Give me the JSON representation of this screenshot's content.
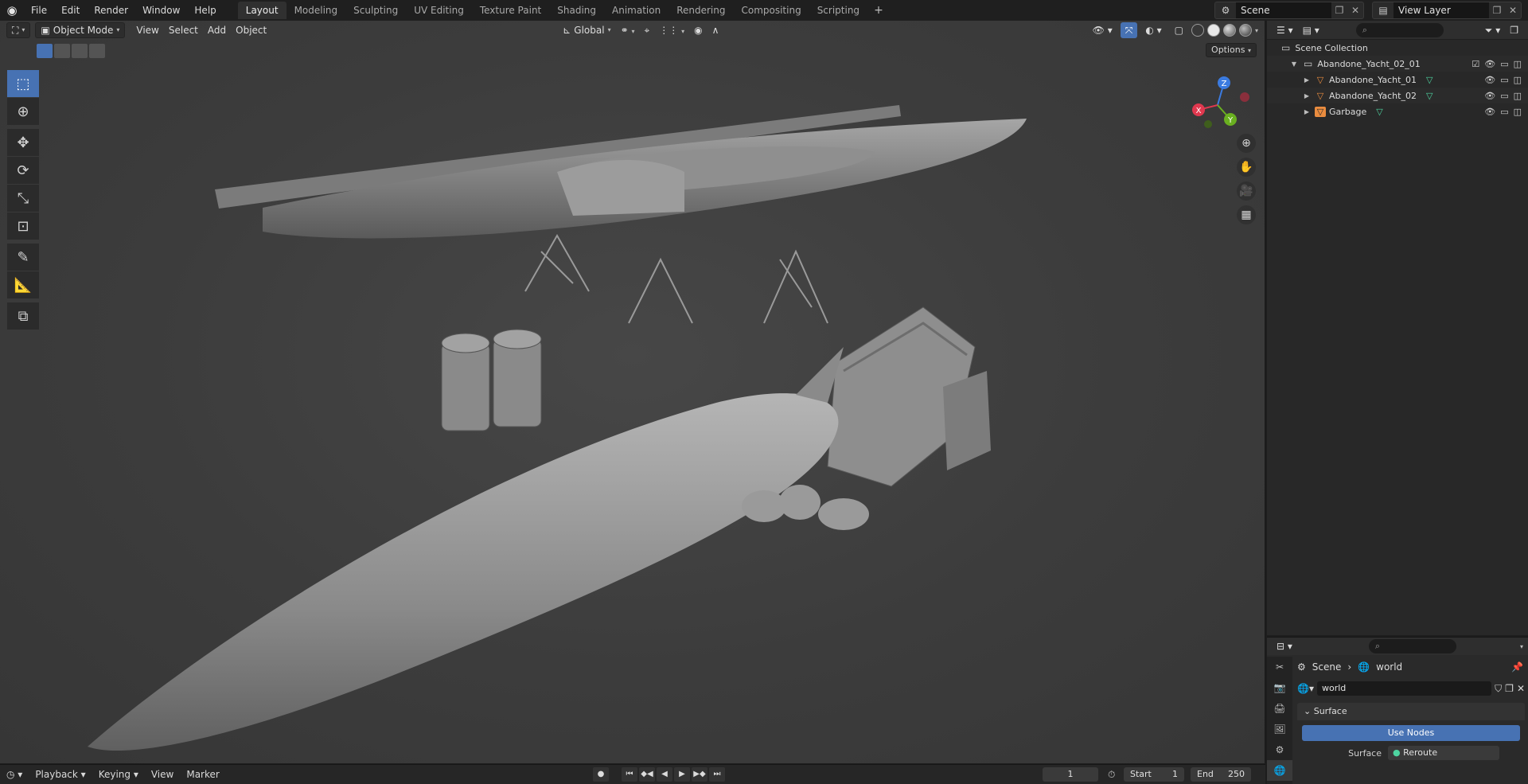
{
  "topbar": {
    "menus": [
      "File",
      "Edit",
      "Render",
      "Window",
      "Help"
    ],
    "workspaces": [
      "Layout",
      "Modeling",
      "Sculpting",
      "UV Editing",
      "Texture Paint",
      "Shading",
      "Animation",
      "Rendering",
      "Compositing",
      "Scripting"
    ],
    "active_workspace": "Layout",
    "add_tab": "+",
    "scene_name": "Scene",
    "view_layer": "View Layer"
  },
  "viewport": {
    "mode": "Object Mode",
    "menus": [
      "View",
      "Select",
      "Add",
      "Object"
    ],
    "transform_orientation": "Global",
    "options": "Options",
    "gizmo": {
      "x": "X",
      "y": "Y",
      "z": "Z"
    }
  },
  "outliner": {
    "root": "Scene Collection",
    "rows": [
      {
        "label": "Abandone_Yacht_02_01",
        "kind": "collection"
      },
      {
        "label": "Abandone_Yacht_01",
        "kind": "object"
      },
      {
        "label": "Abandone_Yacht_02",
        "kind": "object"
      },
      {
        "label": "Garbage",
        "kind": "object"
      }
    ]
  },
  "properties": {
    "breadcrumb_scene": "Scene",
    "breadcrumb_world": "world",
    "world_name": "world",
    "panel_title": "Surface",
    "use_nodes": "Use Nodes",
    "surface_label": "Surface",
    "surface_value": "Reroute"
  },
  "timeline": {
    "menus": [
      "Playback",
      "Keying",
      "View",
      "Marker"
    ],
    "current_frame": "1",
    "start_label": "Start",
    "start_value": "1",
    "end_label": "End",
    "end_value": "250"
  },
  "colors": {
    "accent": "#4772b3",
    "object_orange": "#ea8c3f",
    "mesh_green": "#4ed4a0"
  }
}
